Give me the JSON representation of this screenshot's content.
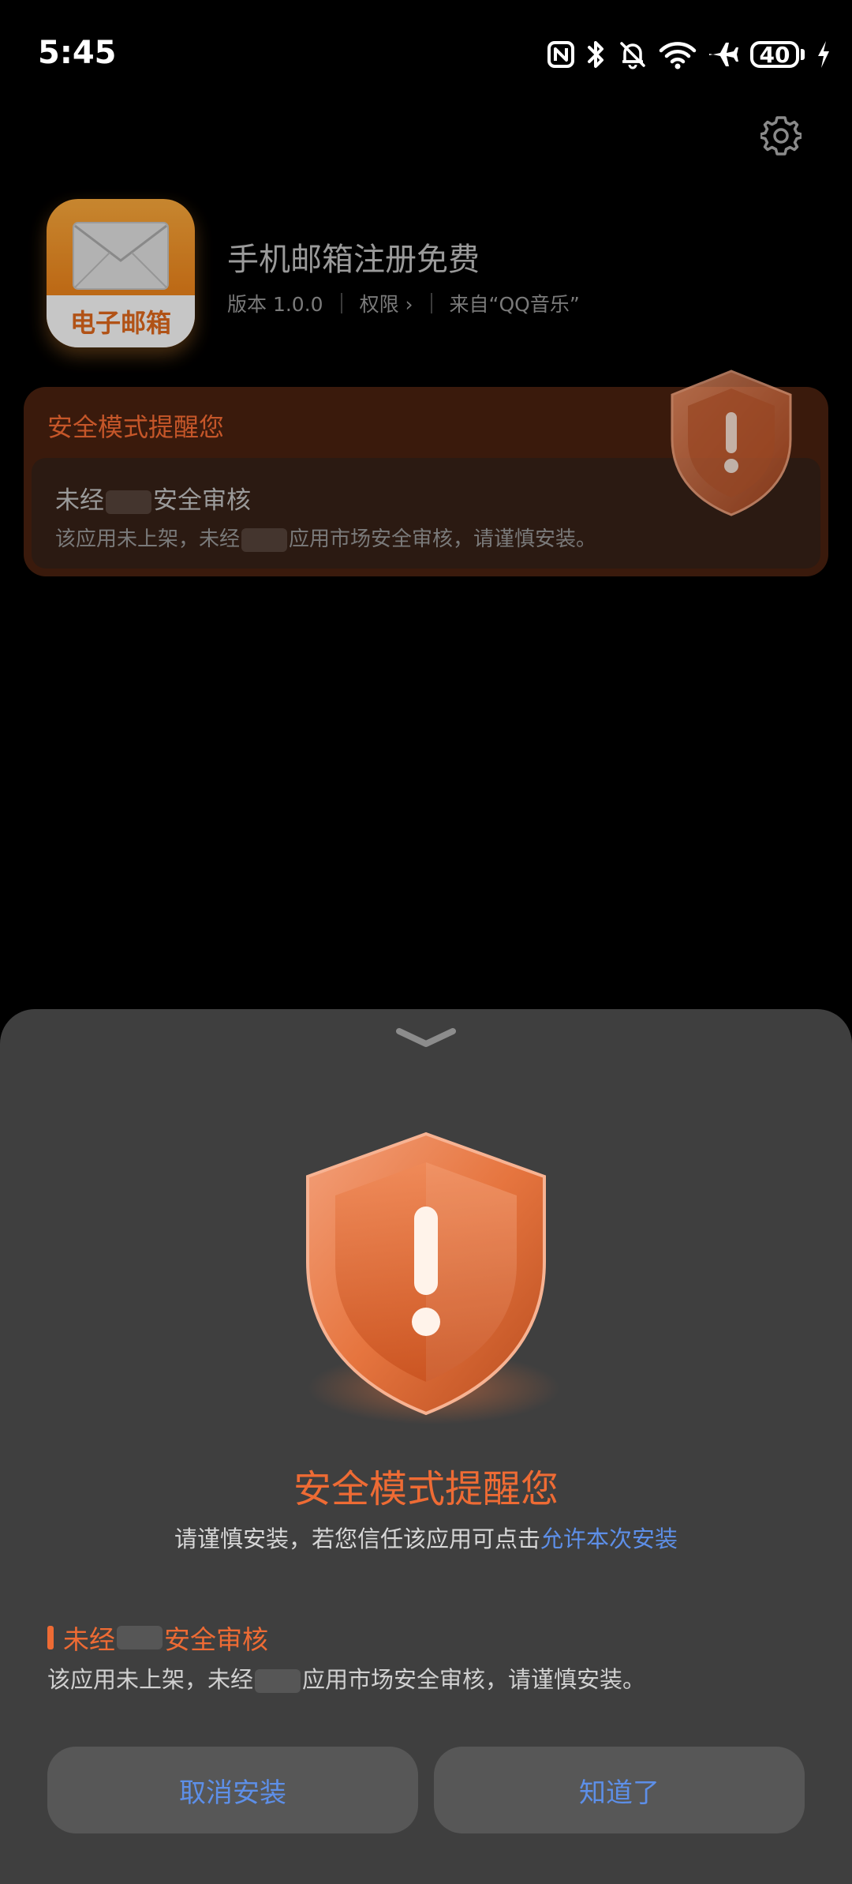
{
  "status": {
    "time": "5:45",
    "battery": "40"
  },
  "app": {
    "name": "手机邮箱注册免费",
    "icon_label": "电子邮箱",
    "version": "版本 1.0.0",
    "permissions": "权限",
    "source": "来自“QQ音乐”"
  },
  "card": {
    "title": "安全模式提醒您",
    "reason_pre": "未经",
    "reason_post": "安全审核",
    "desc_pre": "该应用未上架，未经",
    "desc_post": "应用市场安全审核，请谨慎安装。"
  },
  "sheet": {
    "title": "安全模式提醒您",
    "subtitle": "请谨慎安装，若您信任该应用可点击",
    "allow_link": "允许本次安装",
    "reason_pre": "未经",
    "reason_post": "安全审核",
    "desc_pre": "该应用未上架，未经",
    "desc_post": "应用市场安全审核，请谨慎安装。",
    "cancel_label": "取消安装",
    "ok_label": "知道了"
  },
  "colors": {
    "accent": "#ee6b34",
    "link": "#5d8fe8",
    "sheet_bg": "#3f3f3f",
    "button_bg": "#575757"
  },
  "icons": [
    "nfc-icon",
    "bluetooth-icon",
    "bell-off-icon",
    "wifi-icon",
    "airplane-icon",
    "battery-icon",
    "charging-icon",
    "gear-icon",
    "chevron-down-icon",
    "shield-warning-icon",
    "envelope-icon"
  ]
}
